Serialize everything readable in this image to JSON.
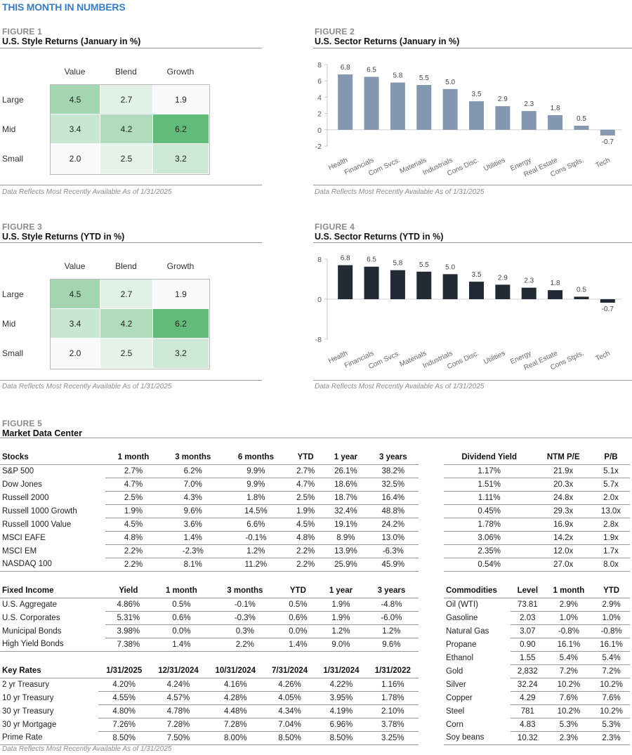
{
  "page_title": "THIS MONTH IN NUMBERS",
  "note": "Data Reflects Most Recently Available As of  1/31/2025",
  "figure1": {
    "label": "FIGURE 1",
    "title": "U.S. Style Returns (January in %)",
    "columns": [
      "Value",
      "Blend",
      "Growth"
    ],
    "rows": [
      "Large",
      "Mid",
      "Small"
    ],
    "values": [
      [
        "4.5",
        "2.7",
        "1.9"
      ],
      [
        "3.4",
        "4.2",
        "6.2"
      ],
      [
        "2.0",
        "2.5",
        "3.2"
      ]
    ],
    "colors": [
      [
        "#a3d5b1",
        "#e2f1e6",
        "#f8f9fb"
      ],
      [
        "#c8e6d1",
        "#b0dcbd",
        "#63bb7a"
      ],
      [
        "#f8f9fb",
        "#e6f3ea",
        "#cde8d5"
      ]
    ]
  },
  "figure3": {
    "label": "FIGURE 3",
    "title": "U.S. Style Returns (YTD in %)",
    "columns": [
      "Value",
      "Blend",
      "Growth"
    ],
    "rows": [
      "Large",
      "Mid",
      "Small"
    ],
    "values": [
      [
        "4.5",
        "2.7",
        "1.9"
      ],
      [
        "3.4",
        "4.2",
        "6.2"
      ],
      [
        "2.0",
        "2.5",
        "3.2"
      ]
    ],
    "colors": [
      [
        "#a3d5b1",
        "#e2f1e6",
        "#f8f9fb"
      ],
      [
        "#c8e6d1",
        "#b0dcbd",
        "#63bb7a"
      ],
      [
        "#f8f9fb",
        "#e6f3ea",
        "#cde8d5"
      ]
    ]
  },
  "figure2": {
    "label": "FIGURE 2",
    "title": "U.S. Sector Returns (January in %)"
  },
  "figure4": {
    "label": "FIGURE 4",
    "title": "U.S. Sector Returns (YTD in %)"
  },
  "chart_data": [
    {
      "type": "heatmap",
      "title": "U.S. Style Returns (January in %)",
      "x": [
        "Value",
        "Blend",
        "Growth"
      ],
      "y": [
        "Large",
        "Mid",
        "Small"
      ],
      "values": [
        [
          4.5,
          2.7,
          1.9
        ],
        [
          3.4,
          4.2,
          6.2
        ],
        [
          2.0,
          2.5,
          3.2
        ]
      ]
    },
    {
      "type": "bar",
      "title": "U.S. Sector Returns (January in %)",
      "categories": [
        "Health",
        "Financials",
        "Com Svcs.",
        "Materials",
        "Industrials",
        "Cons Disc.",
        "Utilities",
        "Energy",
        "Real Estate",
        "Cons Stpls.",
        "Tech"
      ],
      "values": [
        6.8,
        6.5,
        5.8,
        5.5,
        5.0,
        3.5,
        2.9,
        2.3,
        1.8,
        0.5,
        -0.7
      ],
      "labels": [
        "6.8",
        "6.5",
        "5.8",
        "5.5",
        "5.0",
        "3.5",
        "2.9",
        "2.3",
        "1.8",
        "0.5",
        "-0.7"
      ],
      "ylim": [
        -2,
        8
      ],
      "yticks": [
        -2,
        0,
        2,
        4,
        6,
        8
      ],
      "color": "#8497b0",
      "xlabel": "",
      "ylabel": ""
    },
    {
      "type": "heatmap",
      "title": "U.S. Style Returns (YTD in %)",
      "x": [
        "Value",
        "Blend",
        "Growth"
      ],
      "y": [
        "Large",
        "Mid",
        "Small"
      ],
      "values": [
        [
          4.5,
          2.7,
          1.9
        ],
        [
          3.4,
          4.2,
          6.2
        ],
        [
          2.0,
          2.5,
          3.2
        ]
      ]
    },
    {
      "type": "bar",
      "title": "U.S. Sector Returns (YTD in %)",
      "categories": [
        "Health",
        "Financials",
        "Com Svcs.",
        "Materials",
        "Industrials",
        "Cons Disc.",
        "Utilities",
        "Energy",
        "Real Estate",
        "Cons Stpls.",
        "Tech"
      ],
      "values": [
        6.8,
        6.5,
        5.8,
        5.5,
        5.0,
        3.5,
        2.9,
        2.3,
        1.8,
        0.5,
        -0.7
      ],
      "labels": [
        "6.8",
        "6.5",
        "5.8",
        "5.5",
        "5.0",
        "3.5",
        "2.9",
        "2.3",
        "1.8",
        "0.5",
        "-0.7"
      ],
      "ylim": [
        -8,
        8
      ],
      "yticks": [
        -8,
        0,
        8
      ],
      "color": "#222a36",
      "xlabel": "",
      "ylabel": ""
    }
  ],
  "figure5": {
    "label": "FIGURE 5",
    "title": "Market Data Center",
    "stocks": {
      "headers": [
        "Stocks",
        "1 month",
        "3 months",
        "6 months",
        "YTD",
        "1 year",
        "3 years"
      ],
      "rows": [
        [
          "S&P 500",
          "2.7%",
          "6.2%",
          "9.9%",
          "2.7%",
          "26.1%",
          "38.2%"
        ],
        [
          "Dow Jones",
          "4.7%",
          "7.0%",
          "9.9%",
          "4.7%",
          "18.6%",
          "32.5%"
        ],
        [
          "Russell 2000",
          "2.5%",
          "4.3%",
          "1.8%",
          "2.5%",
          "18.7%",
          "16.4%"
        ],
        [
          "Russell 1000 Growth",
          "1.9%",
          "9.6%",
          "14.5%",
          "1.9%",
          "32.4%",
          "48.8%"
        ],
        [
          "Russell 1000 Value",
          "4.5%",
          "3.6%",
          "6.6%",
          "4.5%",
          "19.1%",
          "24.2%"
        ],
        [
          "MSCI EAFE",
          "4.8%",
          "1.4%",
          "-0.1%",
          "4.8%",
          "8.9%",
          "13.0%"
        ],
        [
          "MSCI EM",
          "2.2%",
          "-2.3%",
          "1.2%",
          "2.2%",
          "13.9%",
          "-6.3%"
        ],
        [
          "NASDAQ 100",
          "2.2%",
          "8.1%",
          "11.2%",
          "2.2%",
          "25.9%",
          "45.9%"
        ]
      ]
    },
    "valuation": {
      "headers": [
        "Dividend Yield",
        "NTM P/E",
        "P/B"
      ],
      "rows": [
        [
          "1.17%",
          "21.9x",
          "5.1x"
        ],
        [
          "1.51%",
          "20.3x",
          "5.7x"
        ],
        [
          "1.11%",
          "24.8x",
          "2.0x"
        ],
        [
          "0.45%",
          "29.3x",
          "13.0x"
        ],
        [
          "1.78%",
          "16.9x",
          "2.8x"
        ],
        [
          "3.06%",
          "14.2x",
          "1.9x"
        ],
        [
          "2.35%",
          "12.0x",
          "1.7x"
        ],
        [
          "0.54%",
          "27.0x",
          "8.0x"
        ]
      ]
    },
    "fixed_income": {
      "headers": [
        "Fixed Income",
        "Yield",
        "1 month",
        "3 months",
        "YTD",
        "1 year",
        "3 years"
      ],
      "rows": [
        [
          "U.S. Aggregate",
          "4.86%",
          "0.5%",
          "-0.1%",
          "0.5%",
          "1.9%",
          "-4.8%"
        ],
        [
          "U.S. Corporates",
          "5.31%",
          "0.6%",
          "-0.3%",
          "0.6%",
          "1.9%",
          "-6.0%"
        ],
        [
          "Municipal Bonds",
          "3.98%",
          "0.0%",
          "0.3%",
          "0.0%",
          "1.2%",
          "1.2%"
        ],
        [
          "High Yield Bonds",
          "7.38%",
          "1.4%",
          "2.2%",
          "1.4%",
          "9.0%",
          "9.6%"
        ]
      ]
    },
    "key_rates": {
      "headers": [
        "Key Rates",
        "1/31/2025",
        "12/31/2024",
        "10/31/2024",
        "7/31/2024",
        "1/31/2024",
        "1/31/2022"
      ],
      "rows": [
        [
          "2 yr Treasury",
          "4.20%",
          "4.24%",
          "4.16%",
          "4.26%",
          "4.22%",
          "1.16%"
        ],
        [
          "10 yr Treasury",
          "4.55%",
          "4.57%",
          "4.28%",
          "4.05%",
          "3.95%",
          "1.78%"
        ],
        [
          "30 yr Treasury",
          "4.80%",
          "4.78%",
          "4.48%",
          "4.34%",
          "4.19%",
          "2.10%"
        ],
        [
          "30 yr Mortgage",
          "7.26%",
          "7.28%",
          "7.28%",
          "7.04%",
          "6.96%",
          "3.78%"
        ],
        [
          "Prime Rate",
          "8.50%",
          "7.50%",
          "8.00%",
          "8.50%",
          "8.50%",
          "3.25%"
        ]
      ]
    },
    "commodities": {
      "headers": [
        "Commodities",
        "Level",
        "1 month",
        "YTD"
      ],
      "rows": [
        [
          "Oil (WTI)",
          "73.81",
          "2.9%",
          "2.9%"
        ],
        [
          "Gasoline",
          "2.03",
          "1.0%",
          "1.0%"
        ],
        [
          "Natural Gas",
          "3.07",
          "-0.8%",
          "-0.8%"
        ],
        [
          "Propane",
          "0.90",
          "16.1%",
          "16.1%"
        ],
        [
          "Ethanol",
          "1.55",
          "5.4%",
          "5.4%"
        ],
        [
          "Gold",
          "2,832",
          "7.2%",
          "7.2%"
        ],
        [
          "Silver",
          "32.24",
          "10.2%",
          "10.2%"
        ],
        [
          "Copper",
          "4.29",
          "7.6%",
          "7.6%"
        ],
        [
          "Steel",
          "781",
          "10.2%",
          "10.2%"
        ],
        [
          "Corn",
          "4.83",
          "5.3%",
          "5.3%"
        ],
        [
          "Soy beans",
          "10.32",
          "2.3%",
          "2.3%"
        ]
      ]
    }
  }
}
